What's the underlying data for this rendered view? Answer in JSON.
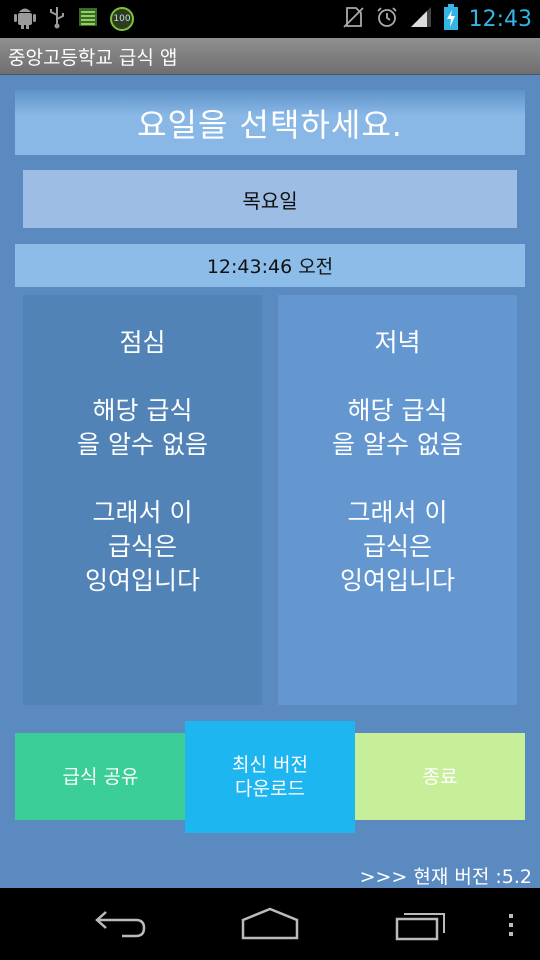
{
  "status_bar": {
    "time": "12:43",
    "battery_badge": "100",
    "icons": [
      "android-debug-icon",
      "usb-icon",
      "notes-icon",
      "battery-100-icon",
      "no-sim-icon",
      "alarm-icon",
      "signal-icon",
      "battery-charging-icon"
    ],
    "time_color": "#35b5e5"
  },
  "app": {
    "title": "중앙고등학교 급식 앱"
  },
  "main": {
    "prompt": "요일을 선택하세요.",
    "selected_day": "목요일",
    "clock": "12:43:46 오전",
    "lunch": {
      "title": "점심",
      "lines1": [
        "해당 급식",
        "을 알수 없음"
      ],
      "lines2": [
        "그래서 이",
        "급식은",
        "잉여입니다"
      ]
    },
    "dinner": {
      "title": "저녁",
      "lines1": [
        "해당 급식",
        "을 알수 없음"
      ],
      "lines2": [
        "그래서 이",
        "급식은",
        "잉여입니다"
      ]
    }
  },
  "buttons": {
    "share": "급식 공유",
    "download_line1": "최신 버전",
    "download_line2": "다운로드",
    "exit": "종료"
  },
  "version": ">>> 현재 버전 :5.2",
  "colors": {
    "background": "#5b8ac0",
    "share": "#3bcf97",
    "download": "#1eb6f0",
    "exit": "#c7ef9a"
  },
  "nav": {
    "icons": [
      "back-icon",
      "home-icon",
      "recent-apps-icon",
      "menu-icon"
    ]
  }
}
